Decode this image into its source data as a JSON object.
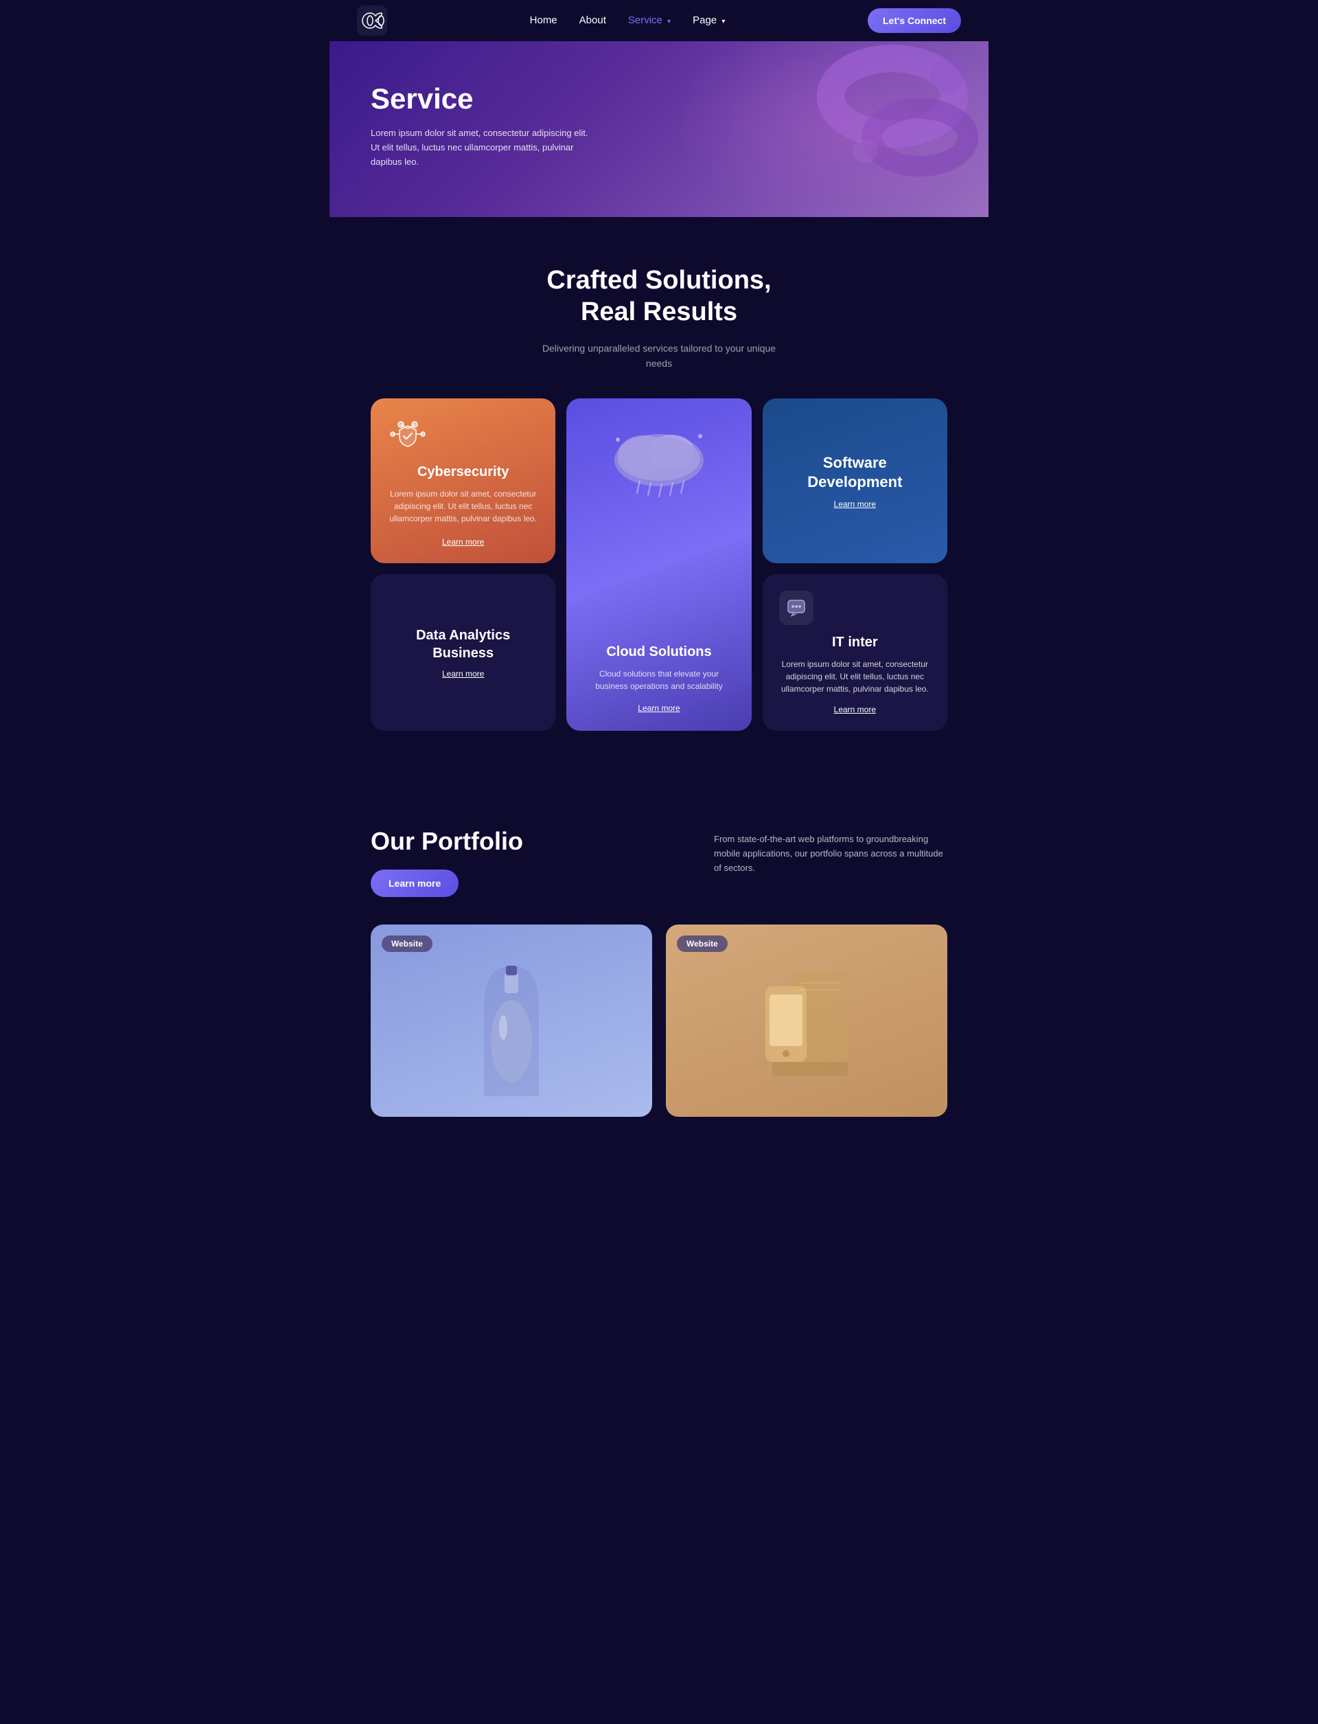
{
  "nav": {
    "logo_alt": "Infinity Loop Logo",
    "links": [
      {
        "label": "Home",
        "active": false,
        "has_arrow": false
      },
      {
        "label": "About",
        "active": false,
        "has_arrow": false
      },
      {
        "label": "Service",
        "active": true,
        "has_arrow": true
      },
      {
        "label": "Page",
        "active": false,
        "has_arrow": true
      }
    ],
    "cta_label": "Let's Connect"
  },
  "hero": {
    "title": "Service",
    "description": "Lorem ipsum dolor sit amet, consectetur adipiscing elit. Ut elit tellus, luctus nec ullamcorper mattis, pulvinar dapibus leo."
  },
  "crafted": {
    "title_line1": "Crafted Solutions,",
    "title_line2": "Real Results",
    "subtitle": "Delivering unparalleled services tailored to your unique needs"
  },
  "services": {
    "cybersecurity": {
      "title": "Cybersecurity",
      "description": "Lorem ipsum dolor sit amet, consectetur adipiscing elit. Ut elit tellus, luctus nec ullamcorper mattis, pulvinar dapibus leo.",
      "learn_more": "Learn more"
    },
    "cloud": {
      "title": "Cloud Solutions",
      "description": "Cloud solutions that elevate your business operations and scalability",
      "learn_more": "Learn more"
    },
    "software": {
      "title": "Software Development",
      "learn_more": "Learn more"
    },
    "data": {
      "title": "Data Analytics Business",
      "learn_more": "Learn more"
    },
    "it": {
      "title": "IT inter",
      "description": "Lorem ipsum dolor sit amet, consectetur adipiscing elit. Ut elit tellus, luctus nec ullamcorper mattis, pulvinar dapibus leo.",
      "learn_more": "Learn more"
    }
  },
  "portfolio": {
    "title": "Our Portfolio",
    "description": "From state-of-the-art web platforms to groundbreaking mobile applications, our portfolio spans across a multitude of sectors.",
    "learn_more": "Learn more",
    "cards": [
      {
        "badge": "Website",
        "type": "blue"
      },
      {
        "badge": "Website",
        "type": "tan"
      }
    ]
  }
}
